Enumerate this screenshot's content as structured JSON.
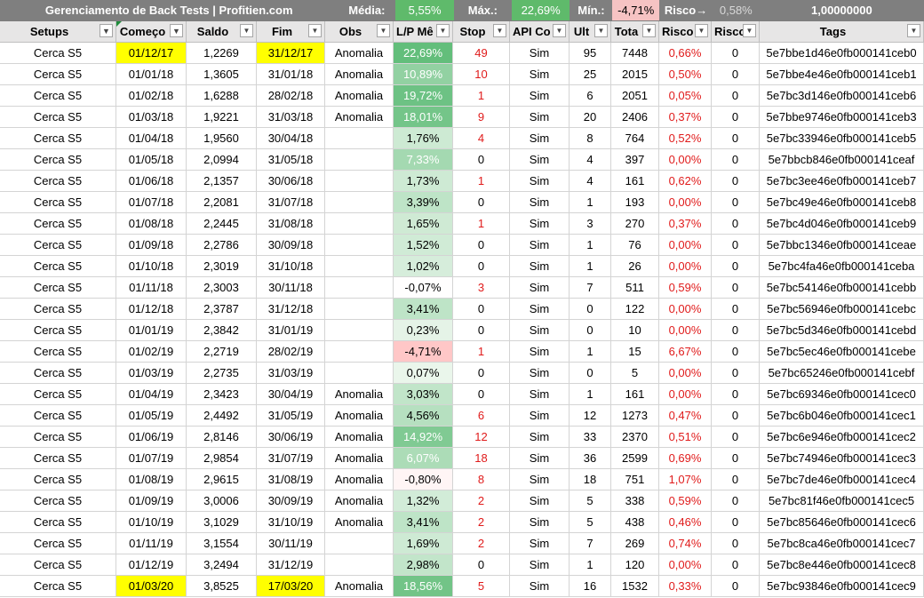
{
  "summary": {
    "title": "Gerenciamento de Back Tests | Profitien.com",
    "media_label": "Média:",
    "media_value": "5,55%",
    "max_label": "Máx.:",
    "max_value": "22,69%",
    "min_label": "Mín.:",
    "min_value": "-4,71%",
    "risco_label": "Risco",
    "risco_arrow": "→",
    "risco_value": "0,58%",
    "total_value": "1,00000000"
  },
  "columns": [
    {
      "label": "Setups",
      "filtered": true
    },
    {
      "label": "Começo",
      "filtered": true
    },
    {
      "label": "Saldo",
      "filtered": false
    },
    {
      "label": "Fim",
      "filtered": false
    },
    {
      "label": "Obs",
      "filtered": false
    },
    {
      "label": "L/P Mê",
      "filtered": false
    },
    {
      "label": "Stop",
      "filtered": false
    },
    {
      "label": "API Co",
      "filtered": false
    },
    {
      "label": "Ult",
      "filtered": false
    },
    {
      "label": "Tota",
      "filtered": false
    },
    {
      "label": "Risco",
      "filtered": false
    },
    {
      "label": "Risco",
      "filtered": false
    },
    {
      "label": "Tags",
      "filtered": false
    }
  ],
  "colors": {
    "lp_positive_strong": "#63be7b",
    "lp_positive_light": "#e3f2e6",
    "lp_negative": "#f8c8c8",
    "red_text": "#e01b1b",
    "highlight": "#ffff00"
  },
  "rows": [
    {
      "setup": "Cerca S5",
      "comeco": "01/12/17",
      "saldo": "1,2269",
      "fim": "31/12/17",
      "obs": "Anomalia",
      "lp": "22,69%",
      "lpv": 22.69,
      "stop": "49",
      "api": "Sim",
      "ult": "95",
      "total": "7448",
      "risco": "0,66%",
      "risco2": "0",
      "tag": "5e7bbe1d46e0fb000141ceb0",
      "hl": true
    },
    {
      "setup": "Cerca S5",
      "comeco": "01/01/18",
      "saldo": "1,3605",
      "fim": "31/01/18",
      "obs": "Anomalia",
      "lp": "10,89%",
      "lpv": 10.89,
      "stop": "10",
      "api": "Sim",
      "ult": "25",
      "total": "2015",
      "risco": "0,50%",
      "risco2": "0",
      "tag": "5e7bbe4e46e0fb000141ceb1",
      "hl": false
    },
    {
      "setup": "Cerca S5",
      "comeco": "01/02/18",
      "saldo": "1,6288",
      "fim": "28/02/18",
      "obs": "Anomalia",
      "lp": "19,72%",
      "lpv": 19.72,
      "stop": "1",
      "api": "Sim",
      "ult": "6",
      "total": "2051",
      "risco": "0,05%",
      "risco2": "0",
      "tag": "5e7bc3d146e0fb000141ceb6",
      "hl": false
    },
    {
      "setup": "Cerca S5",
      "comeco": "01/03/18",
      "saldo": "1,9221",
      "fim": "31/03/18",
      "obs": "Anomalia",
      "lp": "18,01%",
      "lpv": 18.01,
      "stop": "9",
      "api": "Sim",
      "ult": "20",
      "total": "2406",
      "risco": "0,37%",
      "risco2": "0",
      "tag": "5e7bbe9746e0fb000141ceb3",
      "hl": false
    },
    {
      "setup": "Cerca S5",
      "comeco": "01/04/18",
      "saldo": "1,9560",
      "fim": "30/04/18",
      "obs": "",
      "lp": "1,76%",
      "lpv": 1.76,
      "stop": "4",
      "api": "Sim",
      "ult": "8",
      "total": "764",
      "risco": "0,52%",
      "risco2": "0",
      "tag": "5e7bc33946e0fb000141ceb5",
      "hl": false
    },
    {
      "setup": "Cerca S5",
      "comeco": "01/05/18",
      "saldo": "2,0994",
      "fim": "31/05/18",
      "obs": "",
      "lp": "7,33%",
      "lpv": 7.33,
      "stop": "0",
      "api": "Sim",
      "ult": "4",
      "total": "397",
      "risco": "0,00%",
      "risco2": "0",
      "tag": "5e7bbcb846e0fb000141ceaf",
      "hl": false
    },
    {
      "setup": "Cerca S5",
      "comeco": "01/06/18",
      "saldo": "2,1357",
      "fim": "30/06/18",
      "obs": "",
      "lp": "1,73%",
      "lpv": 1.73,
      "stop": "1",
      "api": "Sim",
      "ult": "4",
      "total": "161",
      "risco": "0,62%",
      "risco2": "0",
      "tag": "5e7bc3ee46e0fb000141ceb7",
      "hl": false
    },
    {
      "setup": "Cerca S5",
      "comeco": "01/07/18",
      "saldo": "2,2081",
      "fim": "31/07/18",
      "obs": "",
      "lp": "3,39%",
      "lpv": 3.39,
      "stop": "0",
      "api": "Sim",
      "ult": "1",
      "total": "193",
      "risco": "0,00%",
      "risco2": "0",
      "tag": "5e7bc49e46e0fb000141ceb8",
      "hl": false
    },
    {
      "setup": "Cerca S5",
      "comeco": "01/08/18",
      "saldo": "2,2445",
      "fim": "31/08/18",
      "obs": "",
      "lp": "1,65%",
      "lpv": 1.65,
      "stop": "1",
      "api": "Sim",
      "ult": "3",
      "total": "270",
      "risco": "0,37%",
      "risco2": "0",
      "tag": "5e7bc4d046e0fb000141ceb9",
      "hl": false
    },
    {
      "setup": "Cerca S5",
      "comeco": "01/09/18",
      "saldo": "2,2786",
      "fim": "30/09/18",
      "obs": "",
      "lp": "1,52%",
      "lpv": 1.52,
      "stop": "0",
      "api": "Sim",
      "ult": "1",
      "total": "76",
      "risco": "0,00%",
      "risco2": "0",
      "tag": "5e7bbc1346e0fb000141ceae",
      "hl": false
    },
    {
      "setup": "Cerca S5",
      "comeco": "01/10/18",
      "saldo": "2,3019",
      "fim": "31/10/18",
      "obs": "",
      "lp": "1,02%",
      "lpv": 1.02,
      "stop": "0",
      "api": "Sim",
      "ult": "1",
      "total": "26",
      "risco": "0,00%",
      "risco2": "0",
      "tag": "5e7bc4fa46e0fb000141ceba",
      "hl": false
    },
    {
      "setup": "Cerca S5",
      "comeco": "01/11/18",
      "saldo": "2,3003",
      "fim": "30/11/18",
      "obs": "",
      "lp": "-0,07%",
      "lpv": -0.07,
      "stop": "3",
      "api": "Sim",
      "ult": "7",
      "total": "511",
      "risco": "0,59%",
      "risco2": "0",
      "tag": "5e7bc54146e0fb000141cebb",
      "hl": false
    },
    {
      "setup": "Cerca S5",
      "comeco": "01/12/18",
      "saldo": "2,3787",
      "fim": "31/12/18",
      "obs": "",
      "lp": "3,41%",
      "lpv": 3.41,
      "stop": "0",
      "api": "Sim",
      "ult": "0",
      "total": "122",
      "risco": "0,00%",
      "risco2": "0",
      "tag": "5e7bc56946e0fb000141cebc",
      "hl": false
    },
    {
      "setup": "Cerca S5",
      "comeco": "01/01/19",
      "saldo": "2,3842",
      "fim": "31/01/19",
      "obs": "",
      "lp": "0,23%",
      "lpv": 0.23,
      "stop": "0",
      "api": "Sim",
      "ult": "0",
      "total": "10",
      "risco": "0,00%",
      "risco2": "0",
      "tag": "5e7bc5d346e0fb000141cebd",
      "hl": false
    },
    {
      "setup": "Cerca S5",
      "comeco": "01/02/19",
      "saldo": "2,2719",
      "fim": "28/02/19",
      "obs": "",
      "lp": "-4,71%",
      "lpv": -4.71,
      "stop": "1",
      "api": "Sim",
      "ult": "1",
      "total": "15",
      "risco": "6,67%",
      "risco2": "0",
      "tag": "5e7bc5ec46e0fb000141cebe",
      "hl": false
    },
    {
      "setup": "Cerca S5",
      "comeco": "01/03/19",
      "saldo": "2,2735",
      "fim": "31/03/19",
      "obs": "",
      "lp": "0,07%",
      "lpv": 0.07,
      "stop": "0",
      "api": "Sim",
      "ult": "0",
      "total": "5",
      "risco": "0,00%",
      "risco2": "0",
      "tag": "5e7bc65246e0fb000141cebf",
      "hl": false
    },
    {
      "setup": "Cerca S5",
      "comeco": "01/04/19",
      "saldo": "2,3423",
      "fim": "30/04/19",
      "obs": "Anomalia",
      "lp": "3,03%",
      "lpv": 3.03,
      "stop": "0",
      "api": "Sim",
      "ult": "1",
      "total": "161",
      "risco": "0,00%",
      "risco2": "0",
      "tag": "5e7bc69346e0fb000141cec0",
      "hl": false
    },
    {
      "setup": "Cerca S5",
      "comeco": "01/05/19",
      "saldo": "2,4492",
      "fim": "31/05/19",
      "obs": "Anomalia",
      "lp": "4,56%",
      "lpv": 4.56,
      "stop": "6",
      "api": "Sim",
      "ult": "12",
      "total": "1273",
      "risco": "0,47%",
      "risco2": "0",
      "tag": "5e7bc6b046e0fb000141cec1",
      "hl": false
    },
    {
      "setup": "Cerca S5",
      "comeco": "01/06/19",
      "saldo": "2,8146",
      "fim": "30/06/19",
      "obs": "Anomalia",
      "lp": "14,92%",
      "lpv": 14.92,
      "stop": "12",
      "api": "Sim",
      "ult": "33",
      "total": "2370",
      "risco": "0,51%",
      "risco2": "0",
      "tag": "5e7bc6e946e0fb000141cec2",
      "hl": false
    },
    {
      "setup": "Cerca S5",
      "comeco": "01/07/19",
      "saldo": "2,9854",
      "fim": "31/07/19",
      "obs": "Anomalia",
      "lp": "6,07%",
      "lpv": 6.07,
      "stop": "18",
      "api": "Sim",
      "ult": "36",
      "total": "2599",
      "risco": "0,69%",
      "risco2": "0",
      "tag": "5e7bc74946e0fb000141cec3",
      "hl": false
    },
    {
      "setup": "Cerca S5",
      "comeco": "01/08/19",
      "saldo": "2,9615",
      "fim": "31/08/19",
      "obs": "Anomalia",
      "lp": "-0,80%",
      "lpv": -0.8,
      "stop": "8",
      "api": "Sim",
      "ult": "18",
      "total": "751",
      "risco": "1,07%",
      "risco2": "0",
      "tag": "5e7bc7de46e0fb000141cec4",
      "hl": false
    },
    {
      "setup": "Cerca S5",
      "comeco": "01/09/19",
      "saldo": "3,0006",
      "fim": "30/09/19",
      "obs": "Anomalia",
      "lp": "1,32%",
      "lpv": 1.32,
      "stop": "2",
      "api": "Sim",
      "ult": "5",
      "total": "338",
      "risco": "0,59%",
      "risco2": "0",
      "tag": "5e7bc81f46e0fb000141cec5",
      "hl": false
    },
    {
      "setup": "Cerca S5",
      "comeco": "01/10/19",
      "saldo": "3,1029",
      "fim": "31/10/19",
      "obs": "Anomalia",
      "lp": "3,41%",
      "lpv": 3.41,
      "stop": "2",
      "api": "Sim",
      "ult": "5",
      "total": "438",
      "risco": "0,46%",
      "risco2": "0",
      "tag": "5e7bc85646e0fb000141cec6",
      "hl": false
    },
    {
      "setup": "Cerca S5",
      "comeco": "01/11/19",
      "saldo": "3,1554",
      "fim": "30/11/19",
      "obs": "",
      "lp": "1,69%",
      "lpv": 1.69,
      "stop": "2",
      "api": "Sim",
      "ult": "7",
      "total": "269",
      "risco": "0,74%",
      "risco2": "0",
      "tag": "5e7bc8ca46e0fb000141cec7",
      "hl": false
    },
    {
      "setup": "Cerca S5",
      "comeco": "01/12/19",
      "saldo": "3,2494",
      "fim": "31/12/19",
      "obs": "",
      "lp": "2,98%",
      "lpv": 2.98,
      "stop": "0",
      "api": "Sim",
      "ult": "1",
      "total": "120",
      "risco": "0,00%",
      "risco2": "0",
      "tag": "5e7bc8e446e0fb000141cec8",
      "hl": false
    },
    {
      "setup": "Cerca S5",
      "comeco": "01/03/20",
      "saldo": "3,8525",
      "fim": "17/03/20",
      "obs": "Anomalia",
      "lp": "18,56%",
      "lpv": 18.56,
      "stop": "5",
      "api": "Sim",
      "ult": "16",
      "total": "1532",
      "risco": "0,33%",
      "risco2": "0",
      "tag": "5e7bc93846e0fb000141cec9",
      "hl": true
    }
  ]
}
